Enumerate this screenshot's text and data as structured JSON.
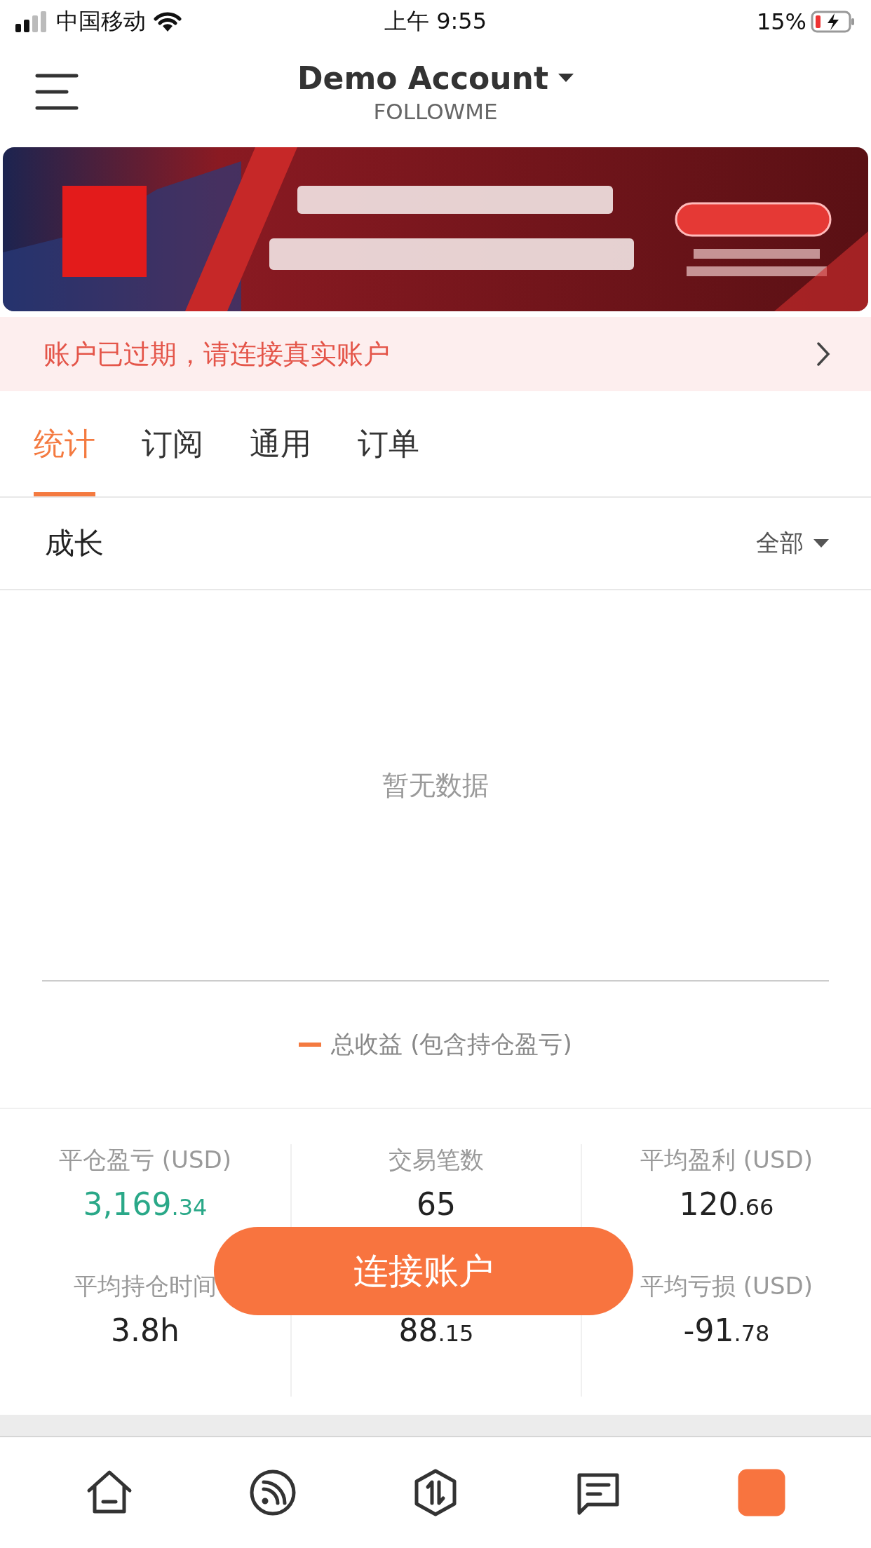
{
  "status_bar": {
    "carrier": "中国移动",
    "time": "上午 9:55",
    "battery": "15%"
  },
  "header": {
    "title": "Demo Account",
    "subtitle": "FOLLOWME"
  },
  "alert": {
    "text": "账户已过期，请连接真实账户"
  },
  "tabs": [
    {
      "label": "统计",
      "selected": true
    },
    {
      "label": "订阅",
      "selected": false
    },
    {
      "label": "通用",
      "selected": false
    },
    {
      "label": "订单",
      "selected": false
    }
  ],
  "section": {
    "title": "成长",
    "filter": "全部"
  },
  "chart": {
    "empty_text": "暂无数据",
    "legend": "总收益 (包含持仓盈亏)"
  },
  "stats": [
    {
      "label": "平仓盈亏 (USD)",
      "value": "3,169.34",
      "color": "#2aa888"
    },
    {
      "label": "交易笔数",
      "value": "65",
      "color": "#222222"
    },
    {
      "label": "平均盈利 (USD)",
      "value": "120.66",
      "color": "#222222"
    },
    {
      "label": "平均持仓时间",
      "value": "3.8h",
      "color": "#222222"
    },
    {
      "value": "88.15",
      "color": "#222222"
    },
    {
      "label": "平均亏损 (USD)",
      "value": "-91.78",
      "color": "#222222"
    }
  ],
  "connect_button": "连接账户",
  "bottom_nav": [
    {
      "kind": "home",
      "selected": false
    },
    {
      "kind": "feed",
      "selected": false
    },
    {
      "kind": "trade",
      "selected": false
    },
    {
      "kind": "message",
      "selected": false
    },
    {
      "kind": "profile",
      "selected": true
    }
  ]
}
